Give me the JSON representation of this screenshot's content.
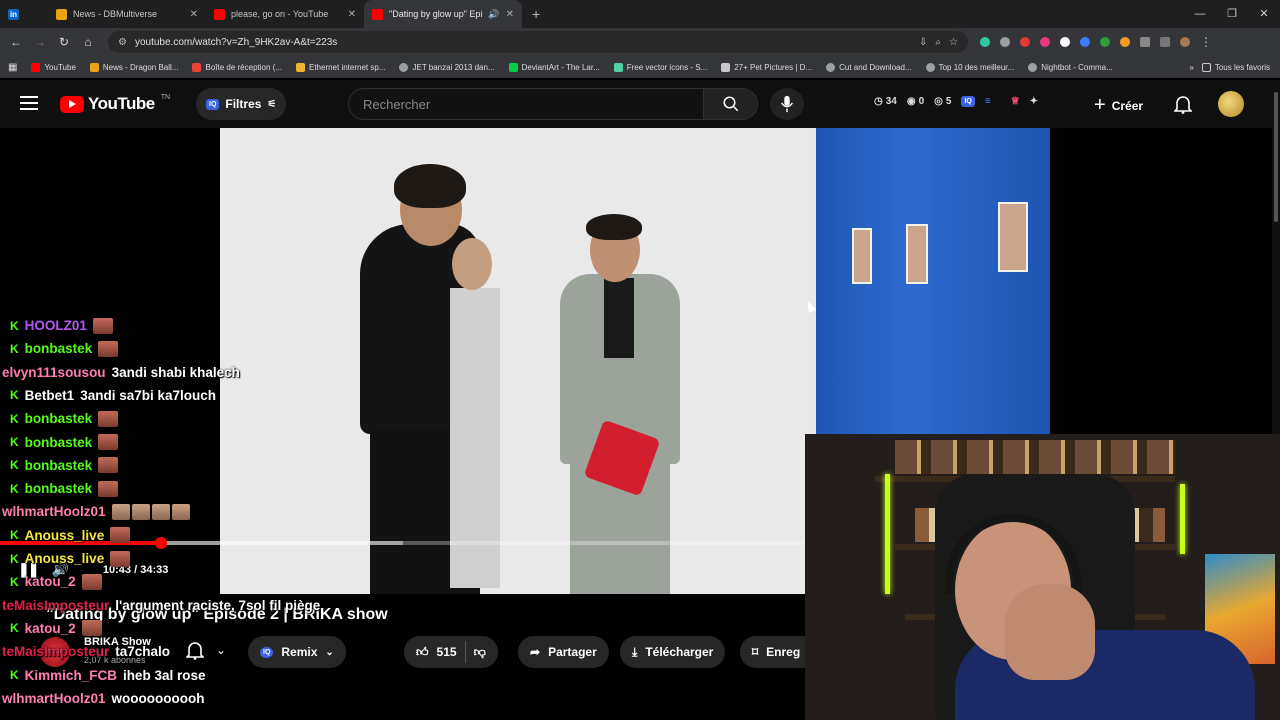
{
  "browser": {
    "tabs": [
      {
        "label": "",
        "icon": "linkedin-icon",
        "color": "#0a66c2"
      },
      {
        "label": "News - DBMultiverse",
        "icon": "dbmultiverse-icon",
        "color": "#e8a317"
      },
      {
        "label": "please, go on - YouTube",
        "icon": "youtube-icon",
        "color": "#ff0000"
      },
      {
        "label": "\"Dating by glow up\" Episod",
        "icon": "youtube-icon",
        "color": "#ff0000",
        "active": true
      }
    ],
    "url": "youtube.com/watch?v=Zh_9HK2av-A&t=223s",
    "bookmarks": [
      {
        "label": "YouTube",
        "color": "#ff0000"
      },
      {
        "label": "News - Dragon Ball...",
        "color": "#e8a317"
      },
      {
        "label": "Boîte de réception (...",
        "color": "#ea4335"
      },
      {
        "label": "Ethernet internet sp...",
        "color": "#f2b233"
      },
      {
        "label": "JET banzai 2013 dan...",
        "color": "#9aa0a6"
      },
      {
        "label": "DeviantArt - The Lar...",
        "color": "#05cc47"
      },
      {
        "label": "Free vector icons - S...",
        "color": "#4fd1a5"
      },
      {
        "label": "27+ Pet Pictures | D...",
        "color": "#c8c8c8"
      },
      {
        "label": "Cut and Download...",
        "color": "#9aa0a6"
      },
      {
        "label": "Top 10 des meilleur...",
        "color": "#9aa0a6"
      },
      {
        "label": "Nightbot - Comma...",
        "color": "#9aa0a6"
      }
    ],
    "all_bookmarks": "Tous les favoris"
  },
  "youtube": {
    "logo": "YouTube",
    "country": "TN",
    "filters": "Filtres",
    "iq_badge": "IQ",
    "search_placeholder": "Rechercher",
    "stats": {
      "time": "34",
      "views": "0",
      "other": "5"
    },
    "create": "Créer"
  },
  "video": {
    "title": "\"Dating by glow up\" Episode 2 | BRIKA show",
    "time": "10:43 / 34:33",
    "progress": 0.2,
    "buffered": 0.5,
    "channel": "BRIKA Show",
    "channel_avatar_text": "BRIKA",
    "subscribers": "2,07 k abonnés",
    "remix": "Remix",
    "likes": "515",
    "share": "Partager",
    "download": "Télécharger",
    "save": "Enreg"
  },
  "chat": [
    {
      "user": "HOOLZ01",
      "color": "#b259f5",
      "badge": true,
      "text": "",
      "emotes": 1
    },
    {
      "user": "bonbastek",
      "color": "#53fc18",
      "badge": true,
      "text": "",
      "emotes": 1
    },
    {
      "user": "elvyn111sousou",
      "color": "#ff7fb0",
      "badge": false,
      "text": "3andi shabi khalech",
      "emotes": 0
    },
    {
      "user": "Betbet1",
      "color": "#ffffff",
      "badge": true,
      "text": "3andi sa7bi ka7louch",
      "emotes": 0
    },
    {
      "user": "bonbastek",
      "color": "#53fc18",
      "badge": true,
      "text": "",
      "emotes": 1
    },
    {
      "user": "bonbastek",
      "color": "#53fc18",
      "badge": true,
      "text": "",
      "emotes": 1
    },
    {
      "user": "bonbastek",
      "color": "#53fc18",
      "badge": true,
      "text": "",
      "emotes": 1
    },
    {
      "user": "bonbastek",
      "color": "#53fc18",
      "badge": true,
      "text": "",
      "emotes": 1
    },
    {
      "user": "wlhmartHoolz01",
      "color": "#ff7fb0",
      "badge": false,
      "text": "",
      "emotes": 4
    },
    {
      "user": "Anouss_live",
      "color": "#f5e642",
      "badge": true,
      "text": "",
      "emotes": 1
    },
    {
      "user": "Anouss_live",
      "color": "#f5e642",
      "badge": true,
      "text": "",
      "emotes": 1
    },
    {
      "user": "katou_2",
      "color": "#ff7fb0",
      "badge": true,
      "text": "",
      "emotes": 1
    },
    {
      "user": "teMaisImposteur",
      "color": "#e0204b",
      "badge": false,
      "text": "l'argument raciste, 7sol fil piège",
      "emotes": 0
    },
    {
      "user": "katou_2",
      "color": "#ff7fb0",
      "badge": true,
      "text": "",
      "emotes": 1
    },
    {
      "user": "teMaisImposteur",
      "color": "#e0204b",
      "badge": false,
      "text": "ta7chalo",
      "emotes": 0
    },
    {
      "user": "Kimmich_FCB",
      "color": "#ff7fb0",
      "badge": true,
      "text": "iheb 3al rose",
      "emotes": 0
    },
    {
      "user": "wlhmartHoolz01",
      "color": "#ff7fb0",
      "badge": false,
      "text": "woooooooooh",
      "emotes": 0
    }
  ],
  "colors": {
    "accent": "#ff0000",
    "kick_green": "#53fc18",
    "youtube_bg": "#0f0f0f"
  }
}
